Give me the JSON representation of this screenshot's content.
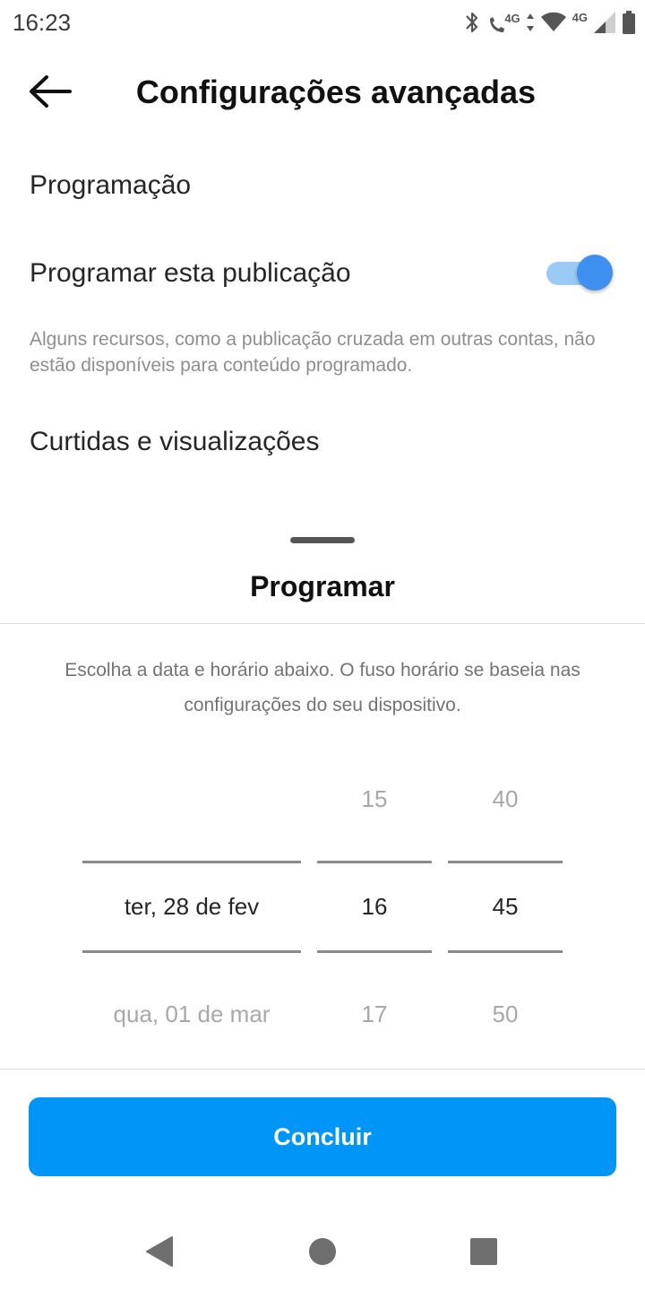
{
  "status_bar": {
    "time": "16:23",
    "network_label": "4G",
    "network_label_2": "4G",
    "icons": [
      "bluetooth-icon",
      "call-4g-icon",
      "data-arrows-icon",
      "wifi-icon",
      "signal-icon",
      "battery-icon"
    ]
  },
  "header": {
    "title": "Configurações avançadas",
    "back_icon": "back-arrow-icon"
  },
  "settings": {
    "section_scheduling": "Programação",
    "schedule_post_label": "Programar esta publicação",
    "schedule_post_enabled": true,
    "schedule_helper": "Alguns recursos, como a publicação cruzada em outras contas, não estão disponíveis para conteúdo programado.",
    "section_likes": "Curtidas e visualizações"
  },
  "sheet": {
    "title": "Programar",
    "description": "Escolha a data e horário abaixo. O fuso horário se baseia nas configurações do seu dispositivo.",
    "picker": {
      "dates": {
        "selected": "ter, 28 de fev",
        "next": "qua, 01 de mar"
      },
      "hours": {
        "prev": "15",
        "selected": "16",
        "next": "17"
      },
      "minutes": {
        "prev": "40",
        "selected": "45",
        "next": "50"
      }
    },
    "done_label": "Concluir"
  },
  "colors": {
    "accent": "#0095f6",
    "toggle_knob": "#3d8ff0",
    "toggle_track": "#9ccaf7",
    "helper_text": "#8e8e8e"
  },
  "nav_bar": {
    "icons": [
      "nav-back-icon",
      "nav-home-icon",
      "nav-recents-icon"
    ]
  }
}
